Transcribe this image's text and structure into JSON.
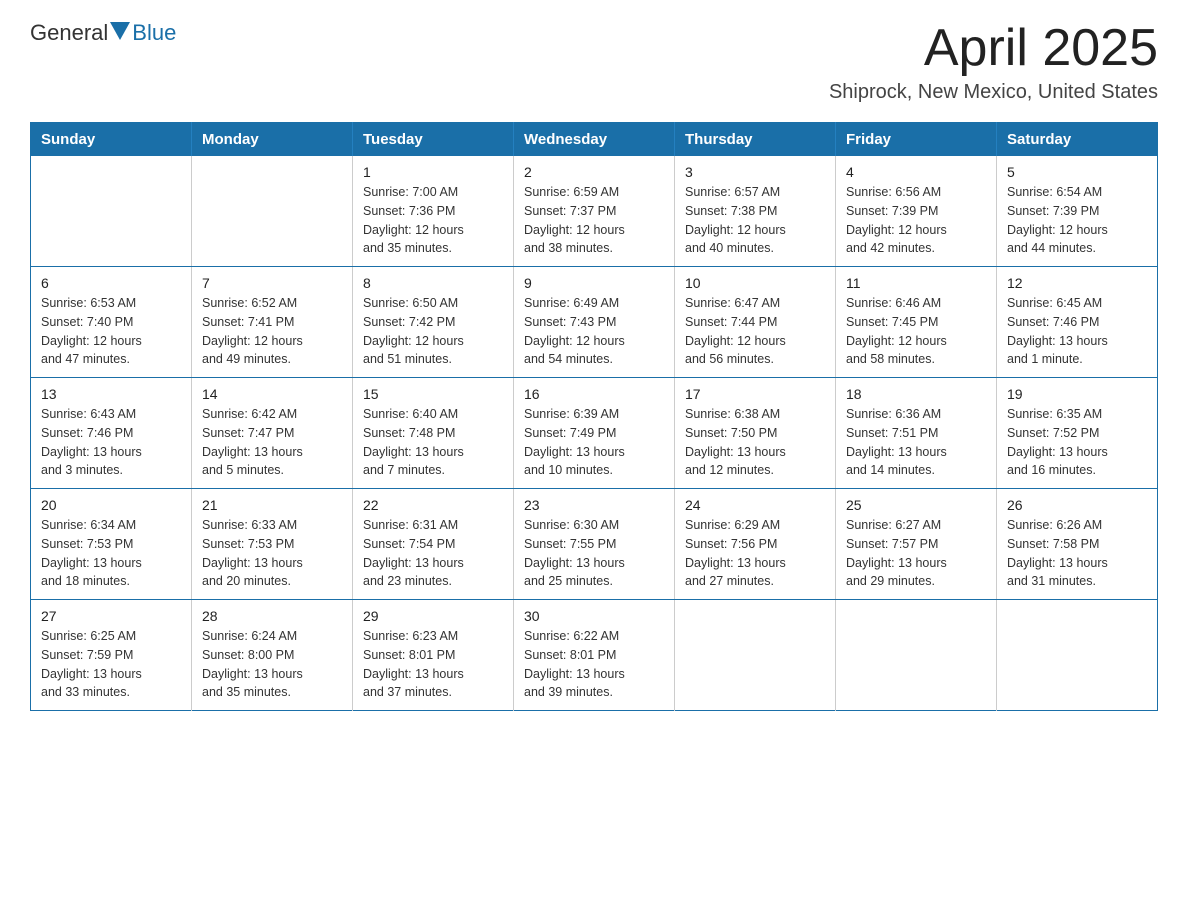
{
  "header": {
    "logo_general": "General",
    "logo_blue": "Blue",
    "month": "April 2025",
    "location": "Shiprock, New Mexico, United States"
  },
  "weekdays": [
    "Sunday",
    "Monday",
    "Tuesday",
    "Wednesday",
    "Thursday",
    "Friday",
    "Saturday"
  ],
  "weeks": [
    [
      {
        "day": "",
        "info": ""
      },
      {
        "day": "",
        "info": ""
      },
      {
        "day": "1",
        "info": "Sunrise: 7:00 AM\nSunset: 7:36 PM\nDaylight: 12 hours\nand 35 minutes."
      },
      {
        "day": "2",
        "info": "Sunrise: 6:59 AM\nSunset: 7:37 PM\nDaylight: 12 hours\nand 38 minutes."
      },
      {
        "day": "3",
        "info": "Sunrise: 6:57 AM\nSunset: 7:38 PM\nDaylight: 12 hours\nand 40 minutes."
      },
      {
        "day": "4",
        "info": "Sunrise: 6:56 AM\nSunset: 7:39 PM\nDaylight: 12 hours\nand 42 minutes."
      },
      {
        "day": "5",
        "info": "Sunrise: 6:54 AM\nSunset: 7:39 PM\nDaylight: 12 hours\nand 44 minutes."
      }
    ],
    [
      {
        "day": "6",
        "info": "Sunrise: 6:53 AM\nSunset: 7:40 PM\nDaylight: 12 hours\nand 47 minutes."
      },
      {
        "day": "7",
        "info": "Sunrise: 6:52 AM\nSunset: 7:41 PM\nDaylight: 12 hours\nand 49 minutes."
      },
      {
        "day": "8",
        "info": "Sunrise: 6:50 AM\nSunset: 7:42 PM\nDaylight: 12 hours\nand 51 minutes."
      },
      {
        "day": "9",
        "info": "Sunrise: 6:49 AM\nSunset: 7:43 PM\nDaylight: 12 hours\nand 54 minutes."
      },
      {
        "day": "10",
        "info": "Sunrise: 6:47 AM\nSunset: 7:44 PM\nDaylight: 12 hours\nand 56 minutes."
      },
      {
        "day": "11",
        "info": "Sunrise: 6:46 AM\nSunset: 7:45 PM\nDaylight: 12 hours\nand 58 minutes."
      },
      {
        "day": "12",
        "info": "Sunrise: 6:45 AM\nSunset: 7:46 PM\nDaylight: 13 hours\nand 1 minute."
      }
    ],
    [
      {
        "day": "13",
        "info": "Sunrise: 6:43 AM\nSunset: 7:46 PM\nDaylight: 13 hours\nand 3 minutes."
      },
      {
        "day": "14",
        "info": "Sunrise: 6:42 AM\nSunset: 7:47 PM\nDaylight: 13 hours\nand 5 minutes."
      },
      {
        "day": "15",
        "info": "Sunrise: 6:40 AM\nSunset: 7:48 PM\nDaylight: 13 hours\nand 7 minutes."
      },
      {
        "day": "16",
        "info": "Sunrise: 6:39 AM\nSunset: 7:49 PM\nDaylight: 13 hours\nand 10 minutes."
      },
      {
        "day": "17",
        "info": "Sunrise: 6:38 AM\nSunset: 7:50 PM\nDaylight: 13 hours\nand 12 minutes."
      },
      {
        "day": "18",
        "info": "Sunrise: 6:36 AM\nSunset: 7:51 PM\nDaylight: 13 hours\nand 14 minutes."
      },
      {
        "day": "19",
        "info": "Sunrise: 6:35 AM\nSunset: 7:52 PM\nDaylight: 13 hours\nand 16 minutes."
      }
    ],
    [
      {
        "day": "20",
        "info": "Sunrise: 6:34 AM\nSunset: 7:53 PM\nDaylight: 13 hours\nand 18 minutes."
      },
      {
        "day": "21",
        "info": "Sunrise: 6:33 AM\nSunset: 7:53 PM\nDaylight: 13 hours\nand 20 minutes."
      },
      {
        "day": "22",
        "info": "Sunrise: 6:31 AM\nSunset: 7:54 PM\nDaylight: 13 hours\nand 23 minutes."
      },
      {
        "day": "23",
        "info": "Sunrise: 6:30 AM\nSunset: 7:55 PM\nDaylight: 13 hours\nand 25 minutes."
      },
      {
        "day": "24",
        "info": "Sunrise: 6:29 AM\nSunset: 7:56 PM\nDaylight: 13 hours\nand 27 minutes."
      },
      {
        "day": "25",
        "info": "Sunrise: 6:27 AM\nSunset: 7:57 PM\nDaylight: 13 hours\nand 29 minutes."
      },
      {
        "day": "26",
        "info": "Sunrise: 6:26 AM\nSunset: 7:58 PM\nDaylight: 13 hours\nand 31 minutes."
      }
    ],
    [
      {
        "day": "27",
        "info": "Sunrise: 6:25 AM\nSunset: 7:59 PM\nDaylight: 13 hours\nand 33 minutes."
      },
      {
        "day": "28",
        "info": "Sunrise: 6:24 AM\nSunset: 8:00 PM\nDaylight: 13 hours\nand 35 minutes."
      },
      {
        "day": "29",
        "info": "Sunrise: 6:23 AM\nSunset: 8:01 PM\nDaylight: 13 hours\nand 37 minutes."
      },
      {
        "day": "30",
        "info": "Sunrise: 6:22 AM\nSunset: 8:01 PM\nDaylight: 13 hours\nand 39 minutes."
      },
      {
        "day": "",
        "info": ""
      },
      {
        "day": "",
        "info": ""
      },
      {
        "day": "",
        "info": ""
      }
    ]
  ]
}
